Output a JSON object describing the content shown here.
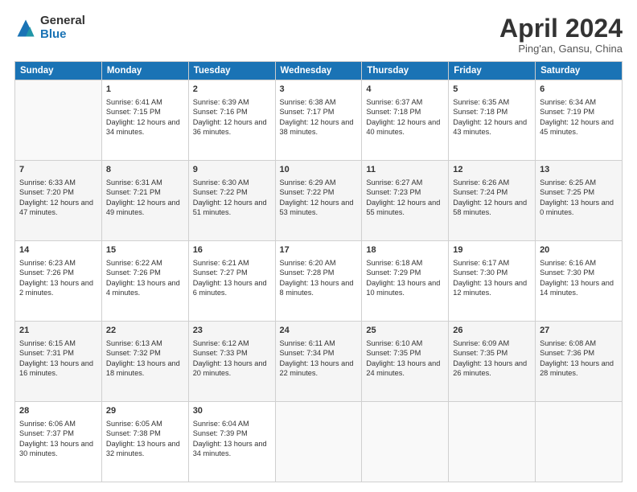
{
  "logo": {
    "general": "General",
    "blue": "Blue"
  },
  "header": {
    "title": "April 2024",
    "subtitle": "Ping'an, Gansu, China"
  },
  "weekdays": [
    "Sunday",
    "Monday",
    "Tuesday",
    "Wednesday",
    "Thursday",
    "Friday",
    "Saturday"
  ],
  "weeks": [
    [
      {
        "day": "",
        "sunrise": "",
        "sunset": "",
        "daylight": ""
      },
      {
        "day": "1",
        "sunrise": "Sunrise: 6:41 AM",
        "sunset": "Sunset: 7:15 PM",
        "daylight": "Daylight: 12 hours and 34 minutes."
      },
      {
        "day": "2",
        "sunrise": "Sunrise: 6:39 AM",
        "sunset": "Sunset: 7:16 PM",
        "daylight": "Daylight: 12 hours and 36 minutes."
      },
      {
        "day": "3",
        "sunrise": "Sunrise: 6:38 AM",
        "sunset": "Sunset: 7:17 PM",
        "daylight": "Daylight: 12 hours and 38 minutes."
      },
      {
        "day": "4",
        "sunrise": "Sunrise: 6:37 AM",
        "sunset": "Sunset: 7:18 PM",
        "daylight": "Daylight: 12 hours and 40 minutes."
      },
      {
        "day": "5",
        "sunrise": "Sunrise: 6:35 AM",
        "sunset": "Sunset: 7:18 PM",
        "daylight": "Daylight: 12 hours and 43 minutes."
      },
      {
        "day": "6",
        "sunrise": "Sunrise: 6:34 AM",
        "sunset": "Sunset: 7:19 PM",
        "daylight": "Daylight: 12 hours and 45 minutes."
      }
    ],
    [
      {
        "day": "7",
        "sunrise": "Sunrise: 6:33 AM",
        "sunset": "Sunset: 7:20 PM",
        "daylight": "Daylight: 12 hours and 47 minutes."
      },
      {
        "day": "8",
        "sunrise": "Sunrise: 6:31 AM",
        "sunset": "Sunset: 7:21 PM",
        "daylight": "Daylight: 12 hours and 49 minutes."
      },
      {
        "day": "9",
        "sunrise": "Sunrise: 6:30 AM",
        "sunset": "Sunset: 7:22 PM",
        "daylight": "Daylight: 12 hours and 51 minutes."
      },
      {
        "day": "10",
        "sunrise": "Sunrise: 6:29 AM",
        "sunset": "Sunset: 7:22 PM",
        "daylight": "Daylight: 12 hours and 53 minutes."
      },
      {
        "day": "11",
        "sunrise": "Sunrise: 6:27 AM",
        "sunset": "Sunset: 7:23 PM",
        "daylight": "Daylight: 12 hours and 55 minutes."
      },
      {
        "day": "12",
        "sunrise": "Sunrise: 6:26 AM",
        "sunset": "Sunset: 7:24 PM",
        "daylight": "Daylight: 12 hours and 58 minutes."
      },
      {
        "day": "13",
        "sunrise": "Sunrise: 6:25 AM",
        "sunset": "Sunset: 7:25 PM",
        "daylight": "Daylight: 13 hours and 0 minutes."
      }
    ],
    [
      {
        "day": "14",
        "sunrise": "Sunrise: 6:23 AM",
        "sunset": "Sunset: 7:26 PM",
        "daylight": "Daylight: 13 hours and 2 minutes."
      },
      {
        "day": "15",
        "sunrise": "Sunrise: 6:22 AM",
        "sunset": "Sunset: 7:26 PM",
        "daylight": "Daylight: 13 hours and 4 minutes."
      },
      {
        "day": "16",
        "sunrise": "Sunrise: 6:21 AM",
        "sunset": "Sunset: 7:27 PM",
        "daylight": "Daylight: 13 hours and 6 minutes."
      },
      {
        "day": "17",
        "sunrise": "Sunrise: 6:20 AM",
        "sunset": "Sunset: 7:28 PM",
        "daylight": "Daylight: 13 hours and 8 minutes."
      },
      {
        "day": "18",
        "sunrise": "Sunrise: 6:18 AM",
        "sunset": "Sunset: 7:29 PM",
        "daylight": "Daylight: 13 hours and 10 minutes."
      },
      {
        "day": "19",
        "sunrise": "Sunrise: 6:17 AM",
        "sunset": "Sunset: 7:30 PM",
        "daylight": "Daylight: 13 hours and 12 minutes."
      },
      {
        "day": "20",
        "sunrise": "Sunrise: 6:16 AM",
        "sunset": "Sunset: 7:30 PM",
        "daylight": "Daylight: 13 hours and 14 minutes."
      }
    ],
    [
      {
        "day": "21",
        "sunrise": "Sunrise: 6:15 AM",
        "sunset": "Sunset: 7:31 PM",
        "daylight": "Daylight: 13 hours and 16 minutes."
      },
      {
        "day": "22",
        "sunrise": "Sunrise: 6:13 AM",
        "sunset": "Sunset: 7:32 PM",
        "daylight": "Daylight: 13 hours and 18 minutes."
      },
      {
        "day": "23",
        "sunrise": "Sunrise: 6:12 AM",
        "sunset": "Sunset: 7:33 PM",
        "daylight": "Daylight: 13 hours and 20 minutes."
      },
      {
        "day": "24",
        "sunrise": "Sunrise: 6:11 AM",
        "sunset": "Sunset: 7:34 PM",
        "daylight": "Daylight: 13 hours and 22 minutes."
      },
      {
        "day": "25",
        "sunrise": "Sunrise: 6:10 AM",
        "sunset": "Sunset: 7:35 PM",
        "daylight": "Daylight: 13 hours and 24 minutes."
      },
      {
        "day": "26",
        "sunrise": "Sunrise: 6:09 AM",
        "sunset": "Sunset: 7:35 PM",
        "daylight": "Daylight: 13 hours and 26 minutes."
      },
      {
        "day": "27",
        "sunrise": "Sunrise: 6:08 AM",
        "sunset": "Sunset: 7:36 PM",
        "daylight": "Daylight: 13 hours and 28 minutes."
      }
    ],
    [
      {
        "day": "28",
        "sunrise": "Sunrise: 6:06 AM",
        "sunset": "Sunset: 7:37 PM",
        "daylight": "Daylight: 13 hours and 30 minutes."
      },
      {
        "day": "29",
        "sunrise": "Sunrise: 6:05 AM",
        "sunset": "Sunset: 7:38 PM",
        "daylight": "Daylight: 13 hours and 32 minutes."
      },
      {
        "day": "30",
        "sunrise": "Sunrise: 6:04 AM",
        "sunset": "Sunset: 7:39 PM",
        "daylight": "Daylight: 13 hours and 34 minutes."
      },
      {
        "day": "",
        "sunrise": "",
        "sunset": "",
        "daylight": ""
      },
      {
        "day": "",
        "sunrise": "",
        "sunset": "",
        "daylight": ""
      },
      {
        "day": "",
        "sunrise": "",
        "sunset": "",
        "daylight": ""
      },
      {
        "day": "",
        "sunrise": "",
        "sunset": "",
        "daylight": ""
      }
    ]
  ]
}
